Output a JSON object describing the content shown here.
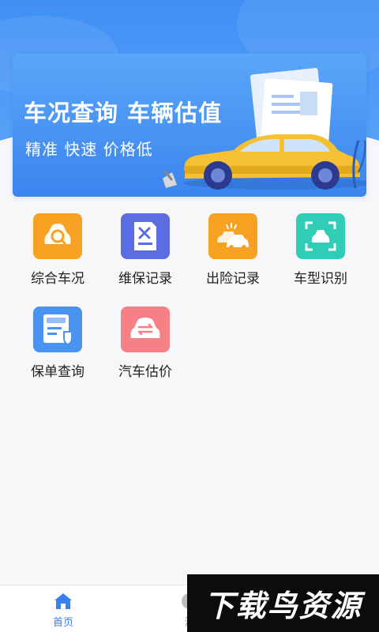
{
  "banner": {
    "title": "车况查询 车辆估值",
    "subtitle": "精准 快速 价格低"
  },
  "grid": {
    "items": [
      {
        "label": "综合车况",
        "icon": "car-search-icon",
        "color": "#f7a223"
      },
      {
        "label": "维保记录",
        "icon": "maintenance-doc-icon",
        "color": "#5b6de0"
      },
      {
        "label": "出险记录",
        "icon": "car-accident-icon",
        "color": "#f7a223"
      },
      {
        "label": "车型识别",
        "icon": "car-scan-icon",
        "color": "#2fcdb5"
      },
      {
        "label": "保单查询",
        "icon": "insurance-policy-icon",
        "color": "#4b93f0"
      },
      {
        "label": "汽车估价",
        "icon": "car-exchange-icon",
        "color": "#f77f86"
      }
    ]
  },
  "tabbar": {
    "tabs": [
      {
        "label": "首页",
        "icon": "home-icon",
        "active": true
      },
      {
        "label": "消",
        "icon": "message-icon",
        "active": false
      }
    ],
    "active_color": "#3a7ff0",
    "inactive_color": "#999999"
  },
  "watermark": {
    "text": "下载鸟资源"
  }
}
